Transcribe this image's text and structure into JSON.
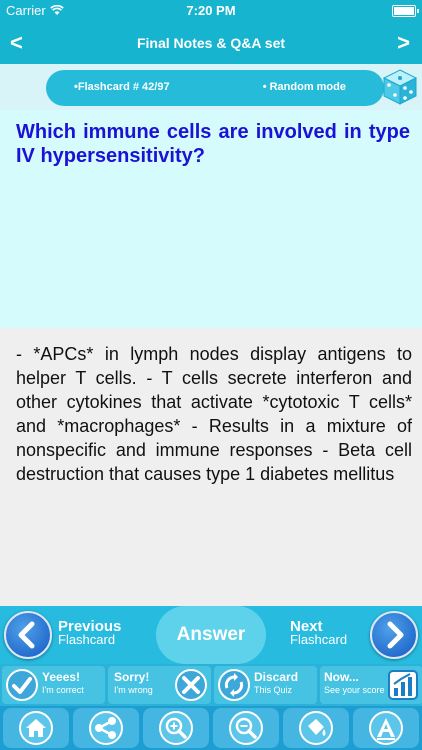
{
  "status_bar": {
    "carrier": "Carrier",
    "time": "7:20 PM"
  },
  "nav": {
    "back_glyph": "<",
    "title": "Final  Notes & Q&A set",
    "forward_glyph": ">"
  },
  "info": {
    "counter": "•Flashcard #  42/97",
    "mode": "• Random mode",
    "dice_icon": "dice-icon"
  },
  "question": {
    "text": "Which immune cells are involved in type IV hypersensitivity?"
  },
  "answer": {
    "text": "- *APCs* in lymph nodes display antigens to helper T cells.  - T cells secrete interferon and other cytokines that activate *cytotoxic T cells* and *macrophages* - Results in a mixture of nonspecific and immune responses - Beta cell destruction that causes type 1 diabetes mellitus"
  },
  "controls": {
    "previous_big": "Previous",
    "previous_small": "Flashcard",
    "answer_label": "Answer",
    "next_big": "Next",
    "next_small": "Flashcard"
  },
  "rating": {
    "correct_big": "Yeees!",
    "correct_small": "I'm correct",
    "wrong_big": "Sorry!",
    "wrong_small": "I'm wrong",
    "discard_big": "Discard",
    "discard_small": "This Quiz",
    "score_big": "Now...",
    "score_small": "See your score"
  },
  "toolbar": {
    "items": [
      "home-icon",
      "share-icon",
      "zoom-in-icon",
      "zoom-out-icon",
      "bucket-icon",
      "font-icon"
    ]
  },
  "colors": {
    "primary": "#17b4d0",
    "question_text": "#1a12d4",
    "question_bg": "#d6fbfd",
    "answer_bg": "#efefef"
  }
}
